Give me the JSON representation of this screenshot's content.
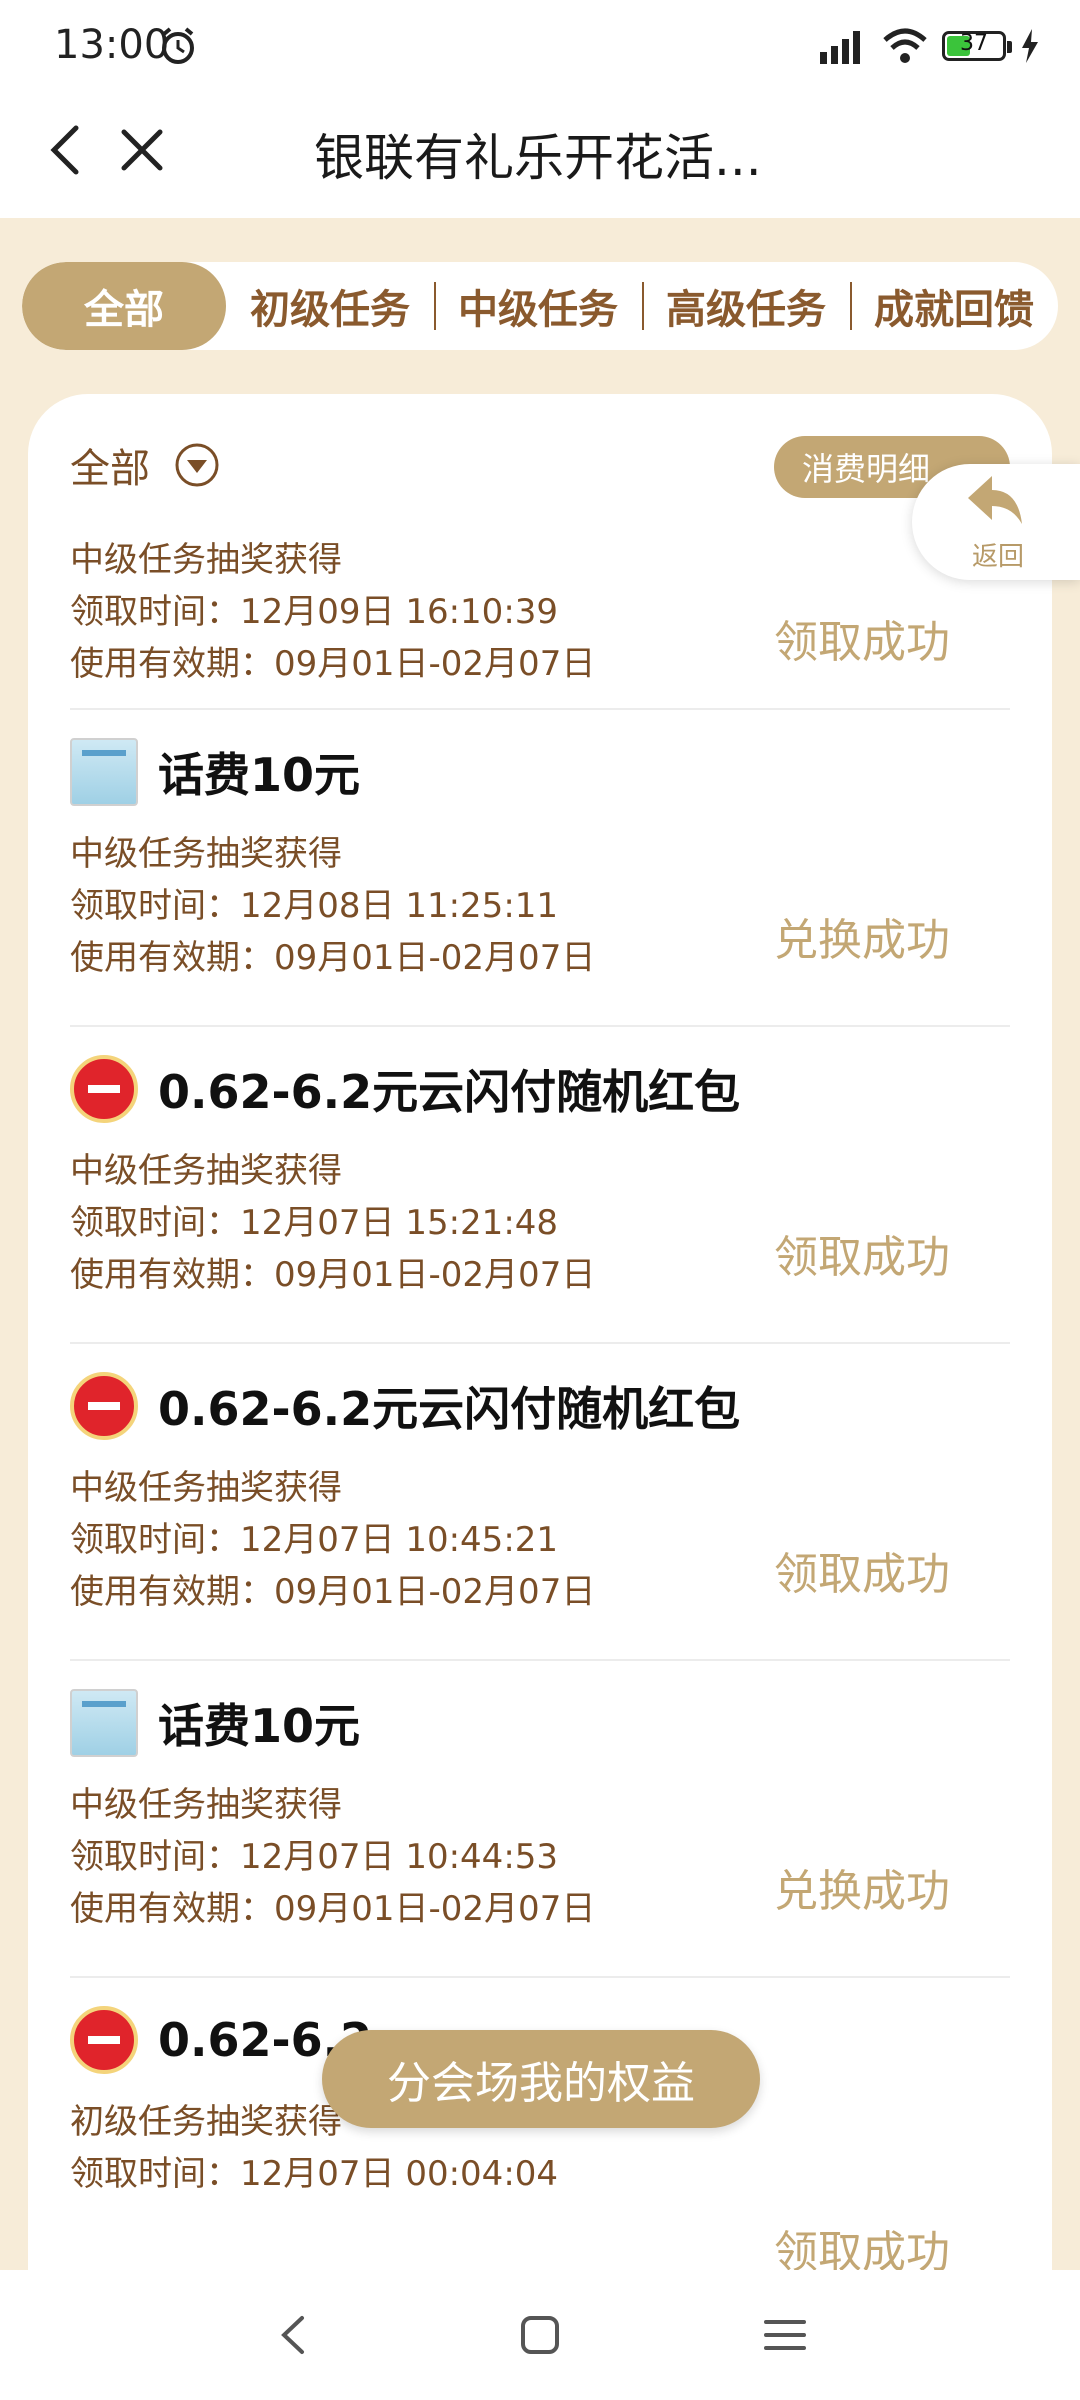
{
  "status_bar": {
    "time": "13:00",
    "battery": "37",
    "icons": [
      "alarm-icon",
      "signal-icon",
      "wifi-icon",
      "battery-icon",
      "charging-icon"
    ]
  },
  "title_bar": {
    "title": "银联有礼乐开花活..."
  },
  "tabs": [
    {
      "label": "全部",
      "active": true
    },
    {
      "label": "初级任务",
      "active": false
    },
    {
      "label": "中级任务",
      "active": false
    },
    {
      "label": "高级任务",
      "active": false
    },
    {
      "label": "成就回馈",
      "active": false
    }
  ],
  "filter": {
    "label": "全部"
  },
  "detail_button": {
    "label": "消费明细"
  },
  "float_back": {
    "label": "返回"
  },
  "entries": [
    {
      "title": "",
      "icon": "none",
      "source": "中级任务抽奖获得",
      "claim_time": "领取时间：12月09日 16:10:39",
      "validity": "使用有效期：09月01日-02月07日",
      "status": "领取成功"
    },
    {
      "title": "话费10元",
      "icon": "phone-credit-icon",
      "source": "中级任务抽奖获得",
      "claim_time": "领取时间：12月08日 11:25:11",
      "validity": "使用有效期：09月01日-02月07日",
      "status": "兑换成功"
    },
    {
      "title": "0.62-6.2元云闪付随机红包",
      "icon": "unionpay-icon",
      "source": "中级任务抽奖获得",
      "claim_time": "领取时间：12月07日 15:21:48",
      "validity": "使用有效期：09月01日-02月07日",
      "status": "领取成功"
    },
    {
      "title": "0.62-6.2元云闪付随机红包",
      "icon": "unionpay-icon",
      "source": "中级任务抽奖获得",
      "claim_time": "领取时间：12月07日 10:45:21",
      "validity": "使用有效期：09月01日-02月07日",
      "status": "领取成功"
    },
    {
      "title": "话费10元",
      "icon": "phone-credit-icon",
      "source": "中级任务抽奖获得",
      "claim_time": "领取时间：12月07日 10:44:53",
      "validity": "使用有效期：09月01日-02月07日",
      "status": "兑换成功"
    },
    {
      "title": "0.62-6.2",
      "icon": "unionpay-icon",
      "source": "初级任务抽奖获得",
      "claim_time": "领取时间：12月07日 00:04:04",
      "validity": "",
      "status": "领取成功"
    }
  ],
  "floating_cta": {
    "label": "分会场我的权益"
  },
  "colors": {
    "accent": "#c3a774",
    "text_brown": "#7a4e27",
    "background": "#f7ecd8"
  }
}
